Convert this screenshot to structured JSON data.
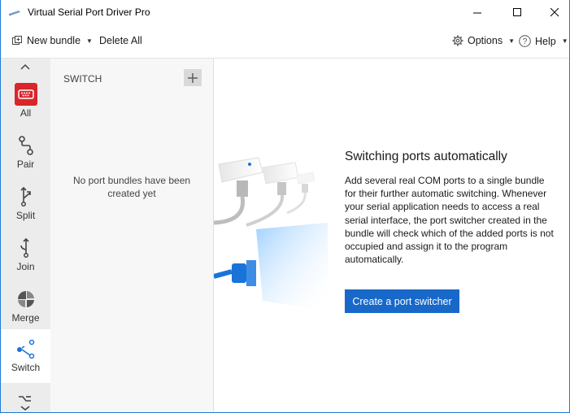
{
  "app": {
    "title": "Virtual Serial Port Driver Pro"
  },
  "toolbar": {
    "new_bundle": "New bundle",
    "delete_all": "Delete All",
    "options": "Options",
    "help": "Help"
  },
  "sidebar": {
    "items": [
      {
        "label": "All",
        "icon": "serial-port-icon"
      },
      {
        "label": "Pair",
        "icon": "pair-icon"
      },
      {
        "label": "Split",
        "icon": "split-icon"
      },
      {
        "label": "Join",
        "icon": "join-icon"
      },
      {
        "label": "Merge",
        "icon": "merge-icon"
      },
      {
        "label": "Switch",
        "icon": "switch-icon",
        "active": true
      }
    ]
  },
  "middle": {
    "header": "SWITCH",
    "empty_message": "No port bundles have been created yet"
  },
  "content": {
    "heading": "Switching ports automatically",
    "description": "Add several real COM ports to a single bundle for their further automatic switching. Whenever your serial application needs to access a real serial interface, the port switcher created in the bundle will check which of the added ports is not occupied and assign it to the program automatically.",
    "button": "Create a port switcher"
  },
  "colors": {
    "accent": "#1768c9",
    "all_icon_red": "#d9262b",
    "switch_blue": "#1a73d9"
  }
}
